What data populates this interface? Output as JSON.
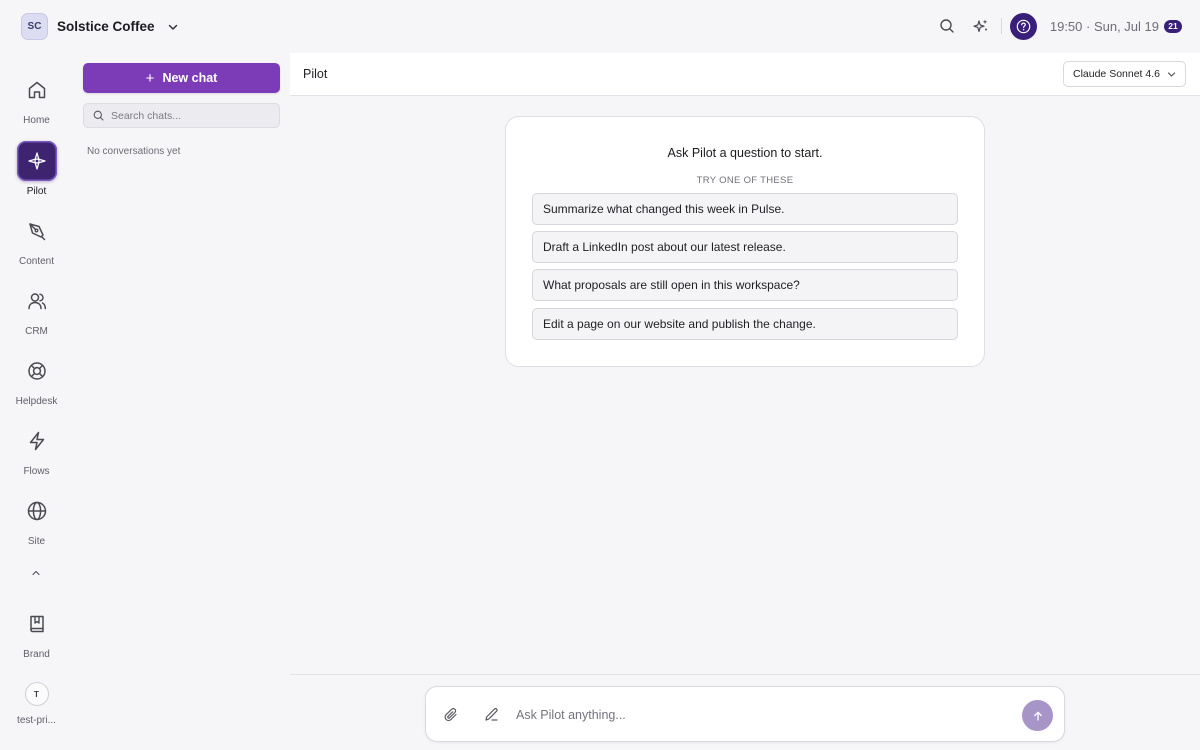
{
  "workspace": {
    "initials": "SC",
    "name": "Solstice Coffee"
  },
  "topbar": {
    "clock": "19:50 · Sun, Jul 19",
    "notification_count": "21",
    "icons": [
      "search-icon",
      "sparkles-icon",
      "help-icon"
    ]
  },
  "rail": {
    "items": [
      {
        "label": "Home",
        "icon": "home-icon"
      },
      {
        "label": "Pilot",
        "icon": "pilot-icon",
        "active": true
      },
      {
        "label": "Content",
        "icon": "pen-nib-icon"
      },
      {
        "label": "CRM",
        "icon": "users-icon"
      },
      {
        "label": "Helpdesk",
        "icon": "lifebuoy-icon"
      },
      {
        "label": "Flows",
        "icon": "lightning-icon"
      },
      {
        "label": "Site",
        "icon": "globe-icon"
      }
    ],
    "brand_label": "Brand",
    "user_initial": "T",
    "user_label": "test-pri..."
  },
  "chat_panel": {
    "new_chat_label": "New chat",
    "search_placeholder": "Search chats...",
    "empty_text": "No conversations yet"
  },
  "main": {
    "title": "Pilot",
    "model": "Claude Sonnet 4.6",
    "prompt_title": "Ask Pilot a question to start.",
    "suggestions_heading": "TRY ONE OF THESE",
    "suggestions": [
      "Summarize what changed this week in Pulse.",
      "Draft a LinkedIn post about our latest release.",
      "What proposals are still open in this workspace?",
      "Edit a page on our website and publish the change."
    ]
  },
  "composer": {
    "placeholder": "Ask Pilot anything..."
  },
  "colors": {
    "accent": "#7d3cb7",
    "accent_dark": "#3a1f7a",
    "send_button": "#a895c8",
    "background": "#f6f6f8"
  }
}
